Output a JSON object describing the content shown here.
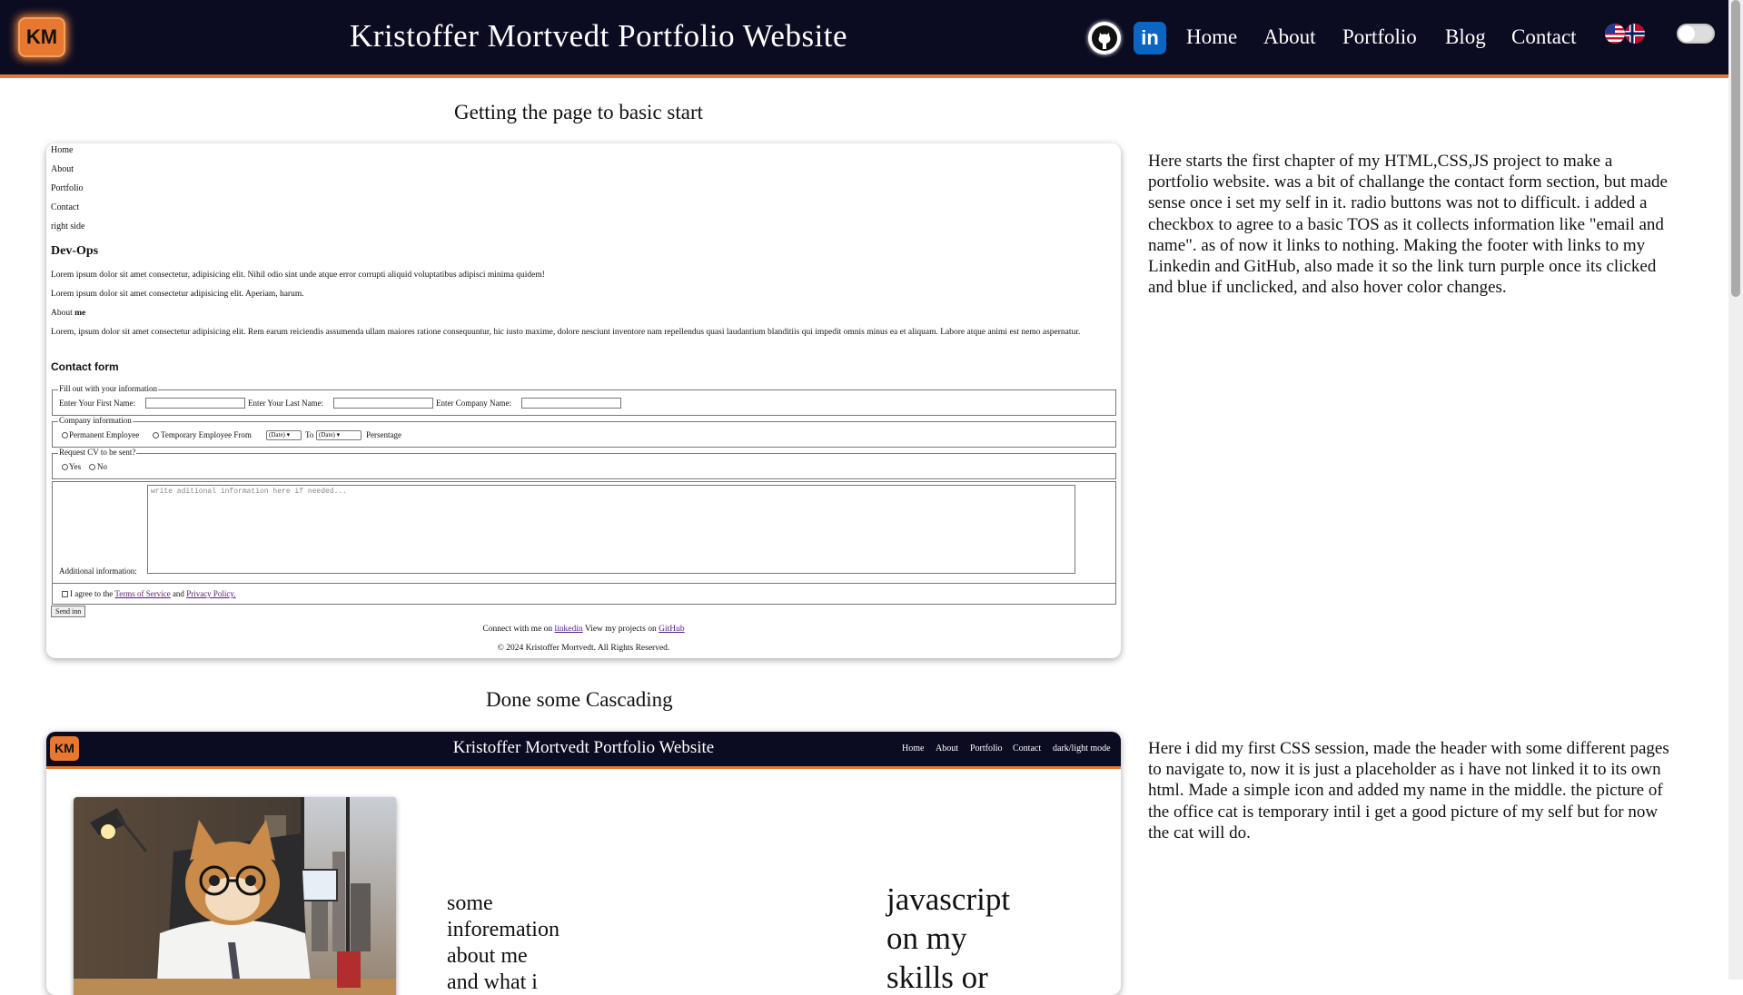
{
  "header": {
    "logo_text": "KM",
    "title": "Kristoffer Mortvedt Portfolio Website",
    "icons": [
      "github-icon",
      "linkedin-icon"
    ],
    "linkedin_glyph": "in",
    "nav": [
      "Home",
      "About",
      "Portfolio",
      "Blog",
      "Contact"
    ],
    "language_icons": [
      "us-flag-icon",
      "norway-flag-icon"
    ],
    "theme_toggle": "dark-light-toggle"
  },
  "sections": [
    {
      "title": "Getting the page to basic start",
      "description": "Here starts the first chapter of my HTML,CSS,JS project to make a portfolio website. was a bit of challange the contact form section, but made sense once i set my self in it. radio buttons was not to difficult. i added a checkbox to agree to a basic TOS as it collects information like \"email and name\". as of now it links to nothing. Making the footer with links to my Linkedin and GitHub, also made it so the link turn purple once its clicked and blue if unclicked, and also hover color changes.",
      "preview": {
        "links": [
          "Home",
          "About",
          "Portfolio",
          "Contact",
          "right side"
        ],
        "heading": "Dev-Ops",
        "para1": "Lorem ipsum dolor sit amet consectetur, adipisicing elit. Nihil odio sint unde atque error corrupti aliquid voluptatibus adipisci minima quidem!",
        "para2": "Lorem ipsum dolor sit amet consectetur adipisicing elit. Aperiam, harum.",
        "about_label_1": "About",
        "about_label_2": "me",
        "para3": "Lorem, ipsum dolor sit amet consectetur adipisicing elit. Rem earum reiciendis assumenda ullam maiores ratione consequuntur, hic iusto maxime, dolore nesciunt inventore nam repellendus quasi laudantium blanditiis qui impedit omnis minus ea et aliquam. Labore atque animi est nemo aspernatur.",
        "contact_heading": "Contact form",
        "fieldset1": {
          "legend": "Fill out with your information",
          "first": "Enter Your First Name:",
          "last": "Enter Your Last Name:",
          "company": "Enter Company Name:"
        },
        "fieldset2": {
          "legend": "Company information",
          "permanent": "Permanent Employee",
          "temporary": "Temporary Employee From",
          "date": "(Date)",
          "to": "To",
          "percentage": "Persentage"
        },
        "fieldset3": {
          "legend": "Request CV to be sent?",
          "yes": "Yes",
          "no": "No"
        },
        "additional": {
          "label": "Additional information:",
          "placeholder": "write aditional information here if needed..."
        },
        "agree": {
          "pre": "I agree to the",
          "tos": "Terms of Service",
          "and": "and",
          "privacy": "Privacy Policy."
        },
        "send": "Send inn",
        "footer": {
          "pre": "Connect with me on",
          "linkedin": "linkedin",
          "mid": "View my projects on",
          "github": "GitHub",
          "copy": "© 2024 Kristoffer Mortvedt. All Rights Reserved."
        }
      }
    },
    {
      "title": "Done some Cascading",
      "description": "Here i did my first CSS session, made the header with some different pages to navigate to, now it is just a placeholder as i have not linked it to its own html. Made a simple icon and added my name in the middle. the picture of the office cat is temporary intil i get a good picture of my self but for now the cat will do.",
      "preview": {
        "logo_text": "KM",
        "title": "Kristoffer Mortvedt Portfolio Website",
        "nav": [
          "Home",
          "About",
          "Portfolio",
          "Contact",
          "dark/light mode"
        ],
        "image": "office-cat-photo",
        "text_left": [
          "some",
          "inforemation",
          "about me",
          "and what i"
        ],
        "text_right": [
          "javascript",
          "on my",
          "skills or"
        ]
      }
    }
  ]
}
